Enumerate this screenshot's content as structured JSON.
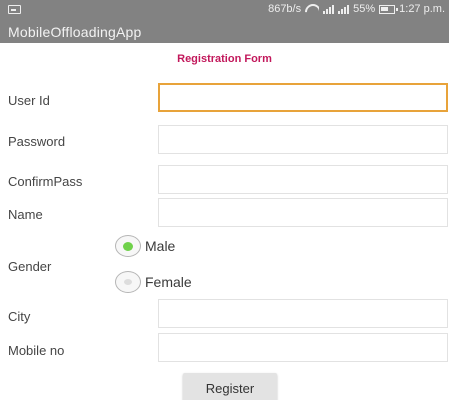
{
  "status_bar": {
    "left_icon": "screenshot-icon",
    "speed": "867b/s",
    "wifi_icon": "wifi-icon",
    "signal_icon": "signal-icon",
    "battery": "55%",
    "battery_icon": "battery-icon",
    "time": "1:27 p.m."
  },
  "app": {
    "title": "MobileOffloadingApp"
  },
  "form": {
    "title": "Registration Form",
    "title_color": "#c2185b",
    "fields": {
      "user_id": {
        "label": "User Id",
        "value": ""
      },
      "password": {
        "label": "Password",
        "value": ""
      },
      "confirm_pass": {
        "label": "ConfirmPass",
        "value": ""
      },
      "name": {
        "label": "Name",
        "value": ""
      }
    },
    "gender": {
      "label": "Gender",
      "options": [
        "Male",
        "Female"
      ],
      "selected": "Male"
    },
    "fields2": {
      "city": {
        "label": "City",
        "value": ""
      },
      "mobile": {
        "label": "Mobile no",
        "value": ""
      }
    },
    "register_label": "Register",
    "focus_color": "#e8a33a",
    "radio_selected_color": "#6fd14a"
  }
}
